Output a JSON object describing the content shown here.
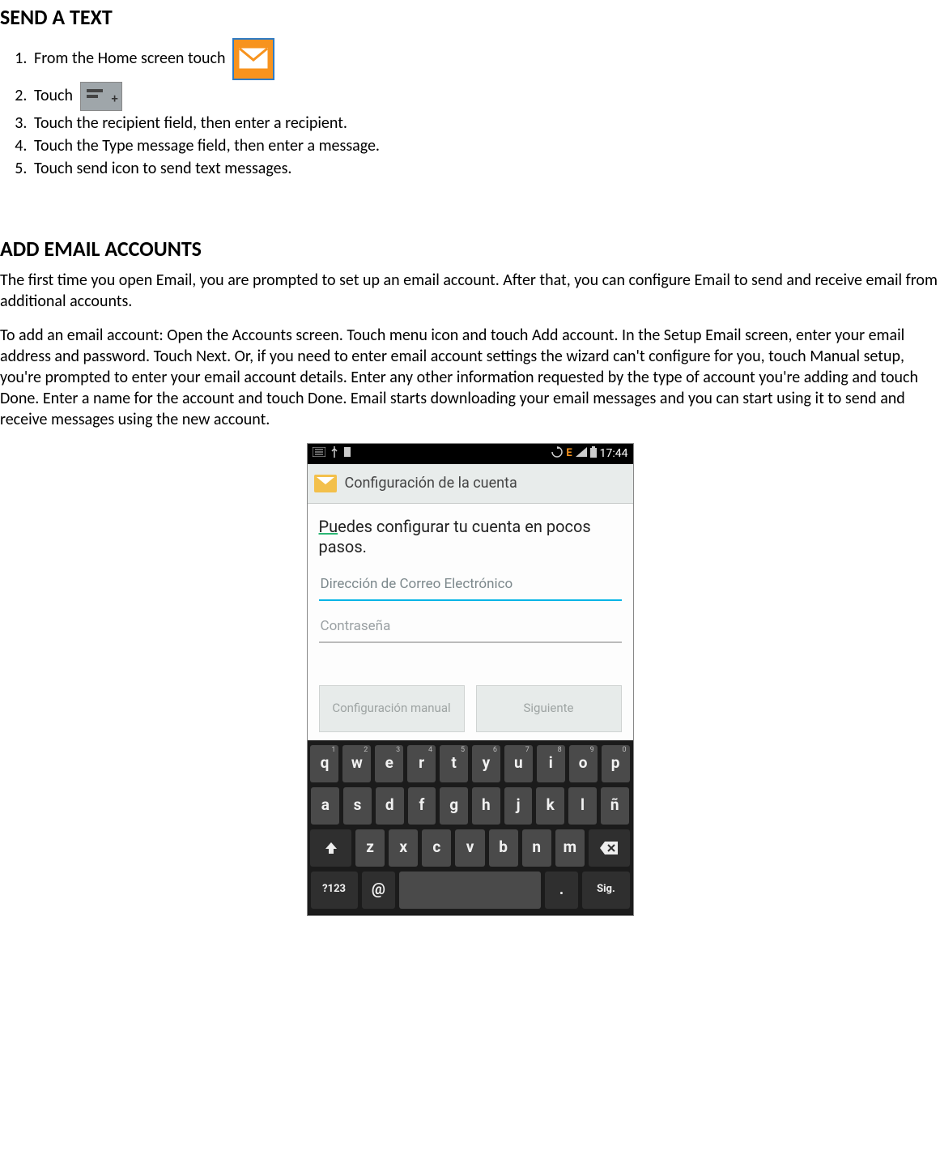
{
  "section1": {
    "heading": "SEND A TEXT",
    "steps": {
      "s1": "From the Home screen touch",
      "s2": "Touch",
      "s3": "Touch the recipient field, then enter a recipient.",
      "s4": "Touch the Type message field, then enter a message.",
      "s5": "Touch send icon to send text messages."
    }
  },
  "section2": {
    "heading": "ADD EMAIL ACCOUNTS",
    "para1": "The first time you open Email, you are prompted to set up an email account. After that, you can configure Email to send and receive email from additional accounts.",
    "para2": "To add an email account: Open the Accounts screen. Touch menu icon and touch Add account. In the Setup Email screen, enter your email address and password. Touch Next. Or, if you need to enter email account settings the wizard can't configure for you, touch Manual setup, you're prompted to enter your email account details. Enter any other information requested by the type of account you're adding and touch Done. Enter a name for the account and touch Done. Email starts downloading your email messages and you can start using it to send and receive messages using the new account."
  },
  "phone": {
    "status": {
      "e_label": "E",
      "time": "17:44"
    },
    "titlebar": "Configuración de la cuenta",
    "prompt_prefix": "Pu",
    "prompt_rest": "edes configurar tu cuenta en pocos pasos.",
    "email_placeholder": "Dirección de Correo Electrónico",
    "password_placeholder": "Contraseña",
    "btn_manual": "Configuración manual",
    "btn_next": "Siguiente",
    "keyboard": {
      "row1": [
        "q",
        "w",
        "e",
        "r",
        "t",
        "y",
        "u",
        "i",
        "o",
        "p"
      ],
      "row1_sup": [
        "1",
        "2",
        "3",
        "4",
        "5",
        "6",
        "7",
        "8",
        "9",
        "0"
      ],
      "row2": [
        "a",
        "s",
        "d",
        "f",
        "g",
        "h",
        "j",
        "k",
        "l",
        "ñ"
      ],
      "row3": [
        "z",
        "x",
        "c",
        "v",
        "b",
        "n",
        "m"
      ],
      "sym": "?123",
      "at": "@",
      "dot": ".",
      "enter": "Sig."
    }
  }
}
